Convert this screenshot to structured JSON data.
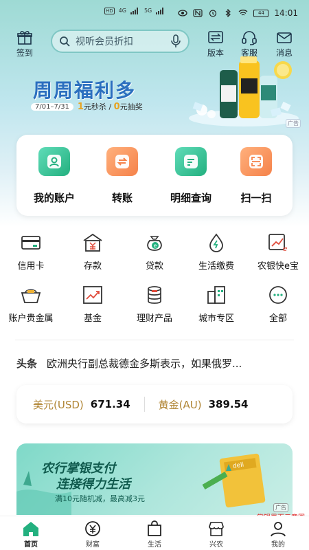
{
  "status_bar": {
    "left_tags": [
      "HD",
      "4G",
      "5G",
      "HD"
    ],
    "time": "14:01",
    "battery": "44"
  },
  "header": {
    "sign_in_label": "签到",
    "search_placeholder": "视听会员折扣",
    "version_label": "版本",
    "service_label": "客服",
    "message_label": "消息"
  },
  "banner": {
    "title": "周周福利多",
    "date_range": "7/01–7/31",
    "promo_num1": "1",
    "promo_text1": "元秒杀 /",
    "promo_num2": "0",
    "promo_text2": "元抽奖",
    "ad_tag": "广告"
  },
  "quick_actions": [
    {
      "label": "我的账户",
      "icon": "account-icon",
      "color": "green"
    },
    {
      "label": "转账",
      "icon": "transfer-icon",
      "color": "orange"
    },
    {
      "label": "明细查询",
      "icon": "details-icon",
      "color": "green"
    },
    {
      "label": "扫一扫",
      "icon": "scan-icon",
      "color": "orange"
    }
  ],
  "services": [
    {
      "label": "信用卡",
      "icon": "credit-card-icon"
    },
    {
      "label": "存款",
      "icon": "deposit-icon"
    },
    {
      "label": "贷款",
      "icon": "loan-icon"
    },
    {
      "label": "生活缴费",
      "icon": "utility-payment-icon"
    },
    {
      "label": "农银快e宝",
      "icon": "quick-e-bao-icon"
    },
    {
      "label": "账户贵金属",
      "icon": "precious-metal-icon"
    },
    {
      "label": "基金",
      "icon": "fund-icon"
    },
    {
      "label": "理财产品",
      "icon": "wealth-product-icon"
    },
    {
      "label": "城市专区",
      "icon": "city-zone-icon"
    },
    {
      "label": "全部",
      "icon": "more-icon"
    }
  ],
  "news": {
    "head": "头条",
    "text": "欧洲央行副总裁德金多斯表示，如果俄罗..."
  },
  "rates": [
    {
      "name": "美元(USD)",
      "value": "671.34"
    },
    {
      "name": "黄金(AU)",
      "value": "389.54"
    }
  ],
  "ad": {
    "line1": "农行掌银支付",
    "line2": "连接得力生活",
    "line3": "满10元随机减，最高减3元",
    "tag": "广告",
    "watermark": "掌银界面示意图"
  },
  "bottom_nav": [
    {
      "label": "首页",
      "active": true
    },
    {
      "label": "财富",
      "active": false
    },
    {
      "label": "生活",
      "active": false
    },
    {
      "label": "兴农",
      "active": false
    },
    {
      "label": "我的",
      "active": false
    }
  ],
  "colors": {
    "brand_green": "#23b07f",
    "accent_orange": "#f5824a",
    "rate_gold": "#b08534",
    "banner_blue": "#2b6fbf"
  }
}
